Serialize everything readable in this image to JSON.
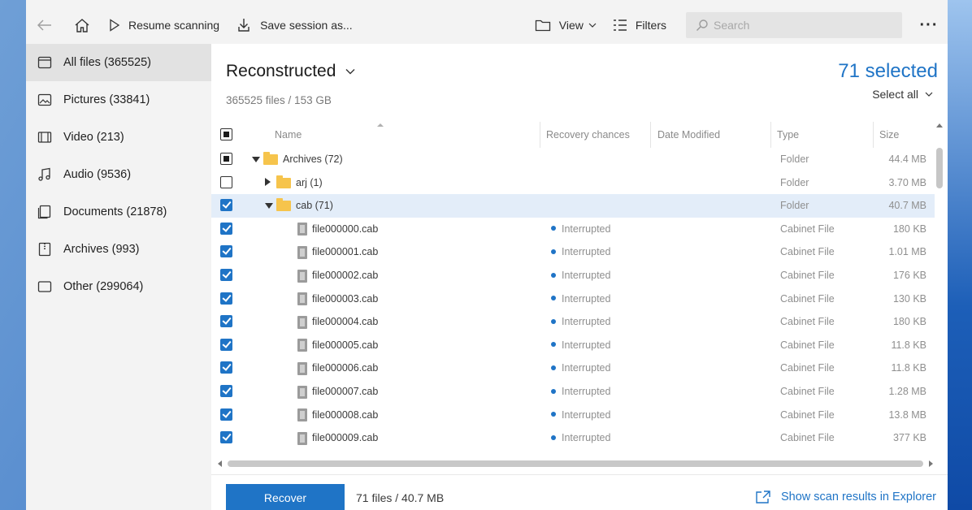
{
  "toolbar": {
    "resume_label": "Resume scanning",
    "save_label": "Save session as...",
    "view_label": "View",
    "filters_label": "Filters",
    "search_placeholder": "Search",
    "more_label": "···"
  },
  "sidebar": {
    "items": [
      {
        "label": "All files (365525)",
        "icon": "file-icon"
      },
      {
        "label": "Pictures (33841)",
        "icon": "image-icon"
      },
      {
        "label": "Video (213)",
        "icon": "video-icon"
      },
      {
        "label": "Audio (9536)",
        "icon": "music-icon"
      },
      {
        "label": "Documents (21878)",
        "icon": "document-icon"
      },
      {
        "label": "Archives (993)",
        "icon": "archive-icon"
      },
      {
        "label": "Other (299064)",
        "icon": "other-icon"
      }
    ]
  },
  "main": {
    "title": "Reconstructed",
    "subtitle": "365525 files / 153 GB",
    "selected_count": "71 selected",
    "select_all_label": "Select all"
  },
  "table": {
    "columns": [
      "Name",
      "Recovery chances",
      "Date Modified",
      "Type",
      "Size"
    ],
    "rows": [
      {
        "name": "Archives (72)",
        "kind": "folder",
        "level": 0,
        "expanded": true,
        "check": "partial",
        "chance": "",
        "type": "Folder",
        "size": "44.4 MB"
      },
      {
        "name": "arj (1)",
        "kind": "folder",
        "level": 1,
        "expanded": false,
        "check": "none",
        "chance": "",
        "type": "Folder",
        "size": "3.70 MB"
      },
      {
        "name": "cab (71)",
        "kind": "folder",
        "level": 1,
        "expanded": true,
        "check": "checked",
        "chance": "",
        "type": "Folder",
        "size": "40.7 MB",
        "highlight": true
      },
      {
        "name": "file000000.cab",
        "kind": "file",
        "level": 2,
        "check": "checked",
        "chance": "Interrupted",
        "type": "Cabinet File",
        "size": "180 KB"
      },
      {
        "name": "file000001.cab",
        "kind": "file",
        "level": 2,
        "check": "checked",
        "chance": "Interrupted",
        "type": "Cabinet File",
        "size": "1.01 MB"
      },
      {
        "name": "file000002.cab",
        "kind": "file",
        "level": 2,
        "check": "checked",
        "chance": "Interrupted",
        "type": "Cabinet File",
        "size": "176 KB"
      },
      {
        "name": "file000003.cab",
        "kind": "file",
        "level": 2,
        "check": "checked",
        "chance": "Interrupted",
        "type": "Cabinet File",
        "size": "130 KB"
      },
      {
        "name": "file000004.cab",
        "kind": "file",
        "level": 2,
        "check": "checked",
        "chance": "Interrupted",
        "type": "Cabinet File",
        "size": "180 KB"
      },
      {
        "name": "file000005.cab",
        "kind": "file",
        "level": 2,
        "check": "checked",
        "chance": "Interrupted",
        "type": "Cabinet File",
        "size": "11.8 KB"
      },
      {
        "name": "file000006.cab",
        "kind": "file",
        "level": 2,
        "check": "checked",
        "chance": "Interrupted",
        "type": "Cabinet File",
        "size": "11.8 KB"
      },
      {
        "name": "file000007.cab",
        "kind": "file",
        "level": 2,
        "check": "checked",
        "chance": "Interrupted",
        "type": "Cabinet File",
        "size": "1.28 MB"
      },
      {
        "name": "file000008.cab",
        "kind": "file",
        "level": 2,
        "check": "checked",
        "chance": "Interrupted",
        "type": "Cabinet File",
        "size": "13.8 MB"
      },
      {
        "name": "file000009.cab",
        "kind": "file",
        "level": 2,
        "check": "checked",
        "chance": "Interrupted",
        "type": "Cabinet File",
        "size": "377 KB"
      }
    ]
  },
  "footer": {
    "recover_label": "Recover",
    "info": "71 files / 40.7 MB",
    "explorer_link": "Show scan results in Explorer"
  },
  "colors": {
    "accent": "#1f74c6",
    "folder": "#f6c44c"
  }
}
